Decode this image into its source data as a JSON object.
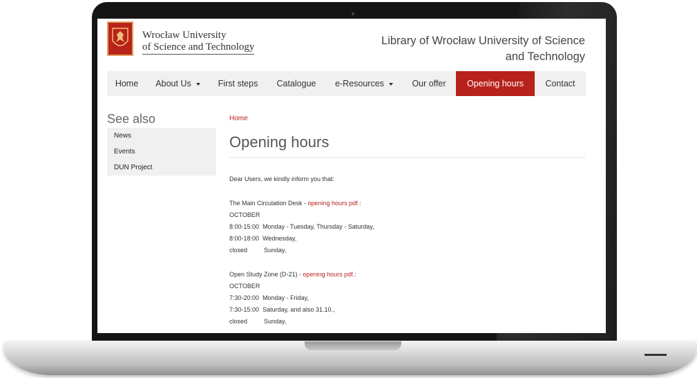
{
  "header": {
    "logo_line1": "Wrocław University",
    "logo_line2": "of Science and Technology",
    "site_title_line1": "Library of Wrocław University of Science",
    "site_title_line2": "and Technology"
  },
  "nav": {
    "items": [
      {
        "label": "Home"
      },
      {
        "label": "About Us"
      },
      {
        "label": "First steps"
      },
      {
        "label": "Catalogue"
      },
      {
        "label": "e-Resources"
      },
      {
        "label": "Our offer"
      },
      {
        "label": "Opening hours"
      },
      {
        "label": "Contact"
      }
    ],
    "active_color": "#b8221c"
  },
  "sidebar": {
    "heading": "See also",
    "items": [
      {
        "label": "News"
      },
      {
        "label": "Events"
      },
      {
        "label": "DUN Project"
      }
    ]
  },
  "main": {
    "breadcrumb": "Home",
    "title": "Opening hours",
    "intro": "Dear Users, we kindly inform you that:",
    "section1": {
      "prefix": "The Main Circulation Desk - ",
      "link": "opening hours pdf.",
      "suffix": ":",
      "month": "OCTOBER",
      "rows": [
        {
          "time": "8:00-15:00",
          "days": "Monday - Tuesday, Thursday - Saturday,"
        },
        {
          "time": "8:00-18:00",
          "days": "Wednesday,"
        },
        {
          "time": "closed",
          "days": "Sunday,"
        }
      ]
    },
    "section2": {
      "prefix": "Open Study Zone (D-21) - ",
      "link": "opening hours pdf.",
      "suffix": ":",
      "month": "OCTOBER",
      "rows": [
        {
          "time": "7:30-20:00",
          "days": "Monday - Friday,"
        },
        {
          "time": "7:30-15:00",
          "days": "Saturday, and also 31.10.,"
        },
        {
          "time": "closed",
          "days": "Sunday,"
        }
      ]
    }
  }
}
